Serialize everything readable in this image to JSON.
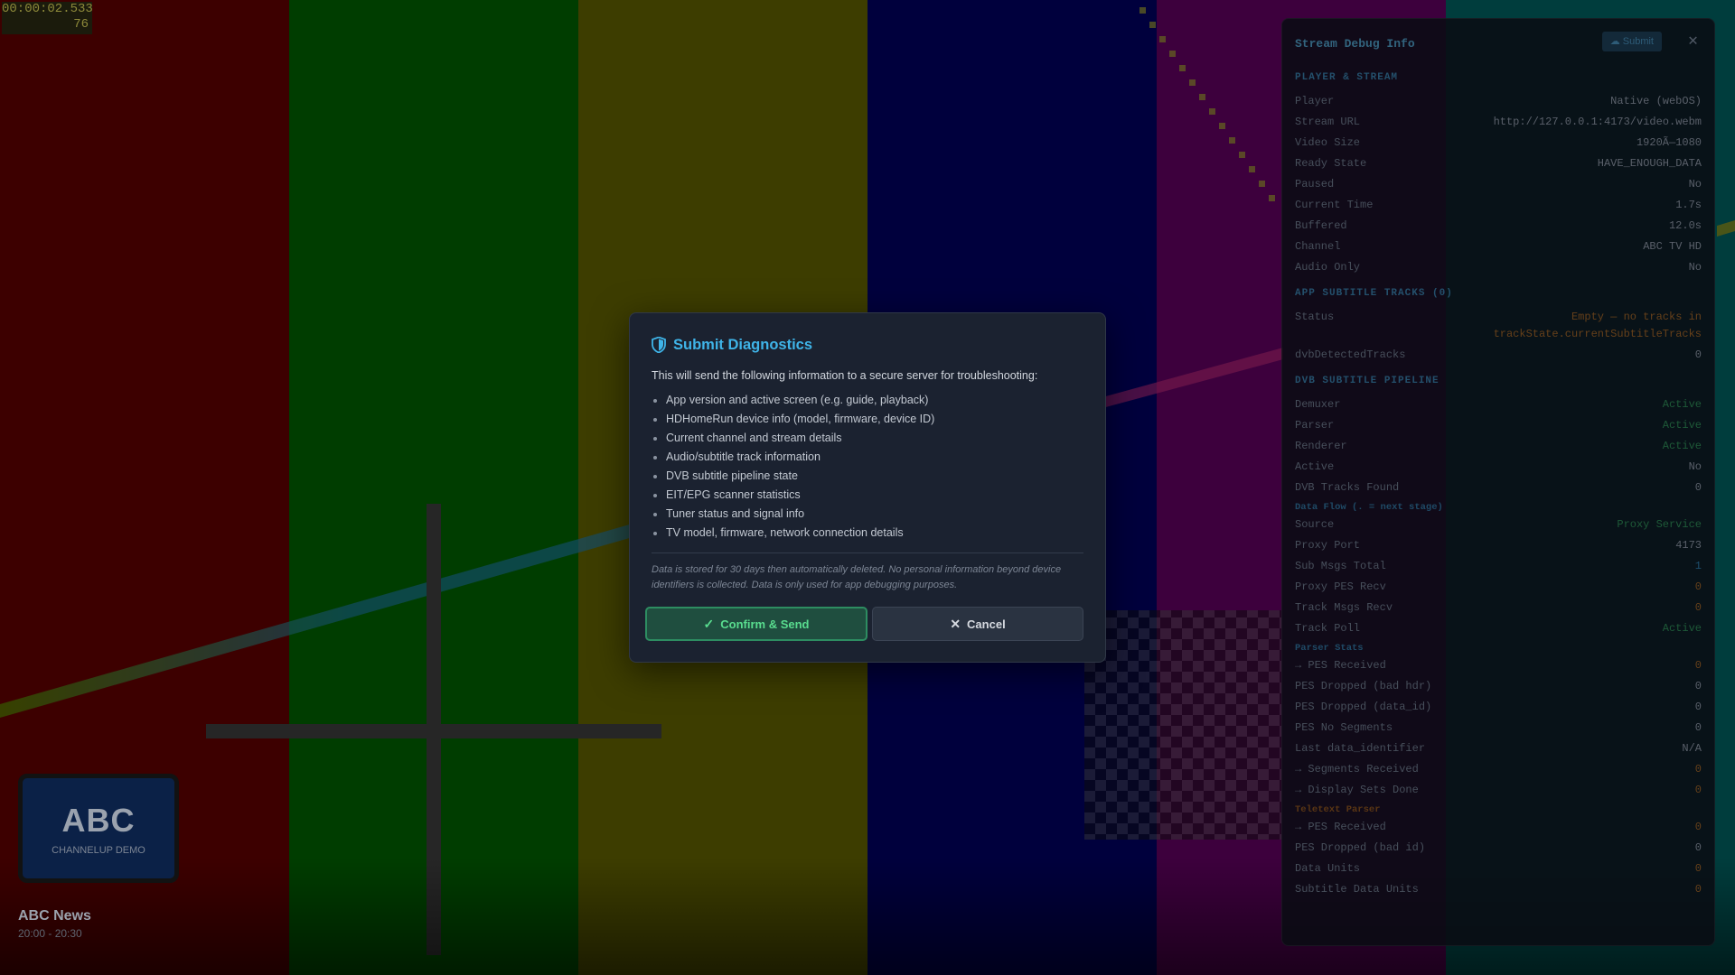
{
  "timecode": {
    "time": "00:00:02.533",
    "frame": "76"
  },
  "channel_logo": {
    "text": "ABC",
    "subtitle": "CHANNELUP DEMO"
  },
  "program": {
    "title": "ABC News",
    "time": "20:00 - 20:30"
  },
  "debug_panel": {
    "title": "Stream Debug Info",
    "submit_label": "Submit",
    "close_glyph": "✕",
    "sections": {
      "player_stream": {
        "title": "PLAYER & STREAM",
        "rows": [
          {
            "key": "Player",
            "value": "Native (webOS)"
          },
          {
            "key": "Stream URL",
            "value": "http://127.0.0.1:4173/video.webm"
          },
          {
            "key": "Video Size",
            "value": "1920Ã—1080"
          },
          {
            "key": "Ready State",
            "value": "HAVE_ENOUGH_DATA"
          },
          {
            "key": "Paused",
            "value": "No"
          },
          {
            "key": "Current Time",
            "value": "1.7s"
          },
          {
            "key": "Buffered",
            "value": "12.0s"
          },
          {
            "key": "Channel",
            "value": "ABC TV HD"
          },
          {
            "key": "Audio Only",
            "value": "No"
          }
        ]
      },
      "app_subtitle": {
        "title": "APP SUBTITLE TRACKS (0)",
        "status_key": "Status",
        "status_value": "Empty — no tracks in trackState.currentSubtitleTracks",
        "dvb_key": "dvbDetectedTracks",
        "dvb_value": "0"
      },
      "dvb_pipeline": {
        "title": "DVB SUBTITLE PIPELINE",
        "rows": [
          {
            "key": "Demuxer",
            "value": "Active"
          },
          {
            "key": "Parser",
            "value": "Active"
          },
          {
            "key": "Renderer",
            "value": "Active"
          },
          {
            "key": "Active",
            "value": "No"
          },
          {
            "key": "DVB Tracks Found",
            "value": "0"
          }
        ],
        "data_flow_title": "Data Flow (. = next stage)",
        "data_flow_rows": [
          {
            "key": "Source",
            "value": "Proxy Service"
          },
          {
            "key": "Proxy Port",
            "value": "4173"
          },
          {
            "key": "Sub Msgs Total",
            "value": "1"
          },
          {
            "key": "Proxy PES Recv",
            "value": "0"
          },
          {
            "key": "Track Msgs Recv",
            "value": "0"
          },
          {
            "key": "Track Poll",
            "value": "Active"
          }
        ],
        "parser_stats_title": "Parser Stats",
        "parser_rows": [
          {
            "key": "→ PES Received",
            "value": "0"
          },
          {
            "key": "PES Dropped (bad hdr)",
            "value": "0"
          },
          {
            "key": "PES Dropped (data_id)",
            "value": "0"
          },
          {
            "key": "PES No Segments",
            "value": "0"
          },
          {
            "key": "Last data_identifier",
            "value": "N/A"
          },
          {
            "key": "→ Segments Received",
            "value": "0"
          },
          {
            "key": "→ Display Sets Done",
            "value": "0"
          }
        ],
        "teletext_title": "Teletext Parser",
        "teletext_rows": [
          {
            "key": "→ PES Received",
            "value": "0"
          },
          {
            "key": "PES Dropped (bad id)",
            "value": "0"
          },
          {
            "key": "Data Units",
            "value": "0"
          },
          {
            "key": "Subtitle Data Units",
            "value": "0"
          }
        ]
      }
    }
  },
  "modal": {
    "title": "Submit Diagnostics",
    "intro": "This will send the following information to a secure server for troubleshooting:",
    "items": [
      "App version and active screen (e.g. guide, playback)",
      "HDHomeRun device info (model, firmware, device ID)",
      "Current channel and stream details",
      "Audio/subtitle track information",
      "DVB subtitle pipeline state",
      "EIT/EPG scanner statistics",
      "Tuner status and signal info",
      "TV model, firmware, network connection details"
    ],
    "note": "Data is stored for 30 days then automatically deleted. No personal information beyond device identifiers is collected. Data is only used for app debugging purposes.",
    "confirm_label": "Confirm & Send",
    "cancel_label": "Cancel"
  },
  "colors": {
    "bar_colors": [
      "#800000",
      "#008000",
      "#808000",
      "#000080",
      "#800080",
      "#008080"
    ],
    "accent": "#3fb4e8",
    "confirm_green": "#59dd8f"
  },
  "icons": [
    "shield-icon",
    "cloud-upload-icon",
    "close-icon",
    "check-icon",
    "x-icon"
  ]
}
